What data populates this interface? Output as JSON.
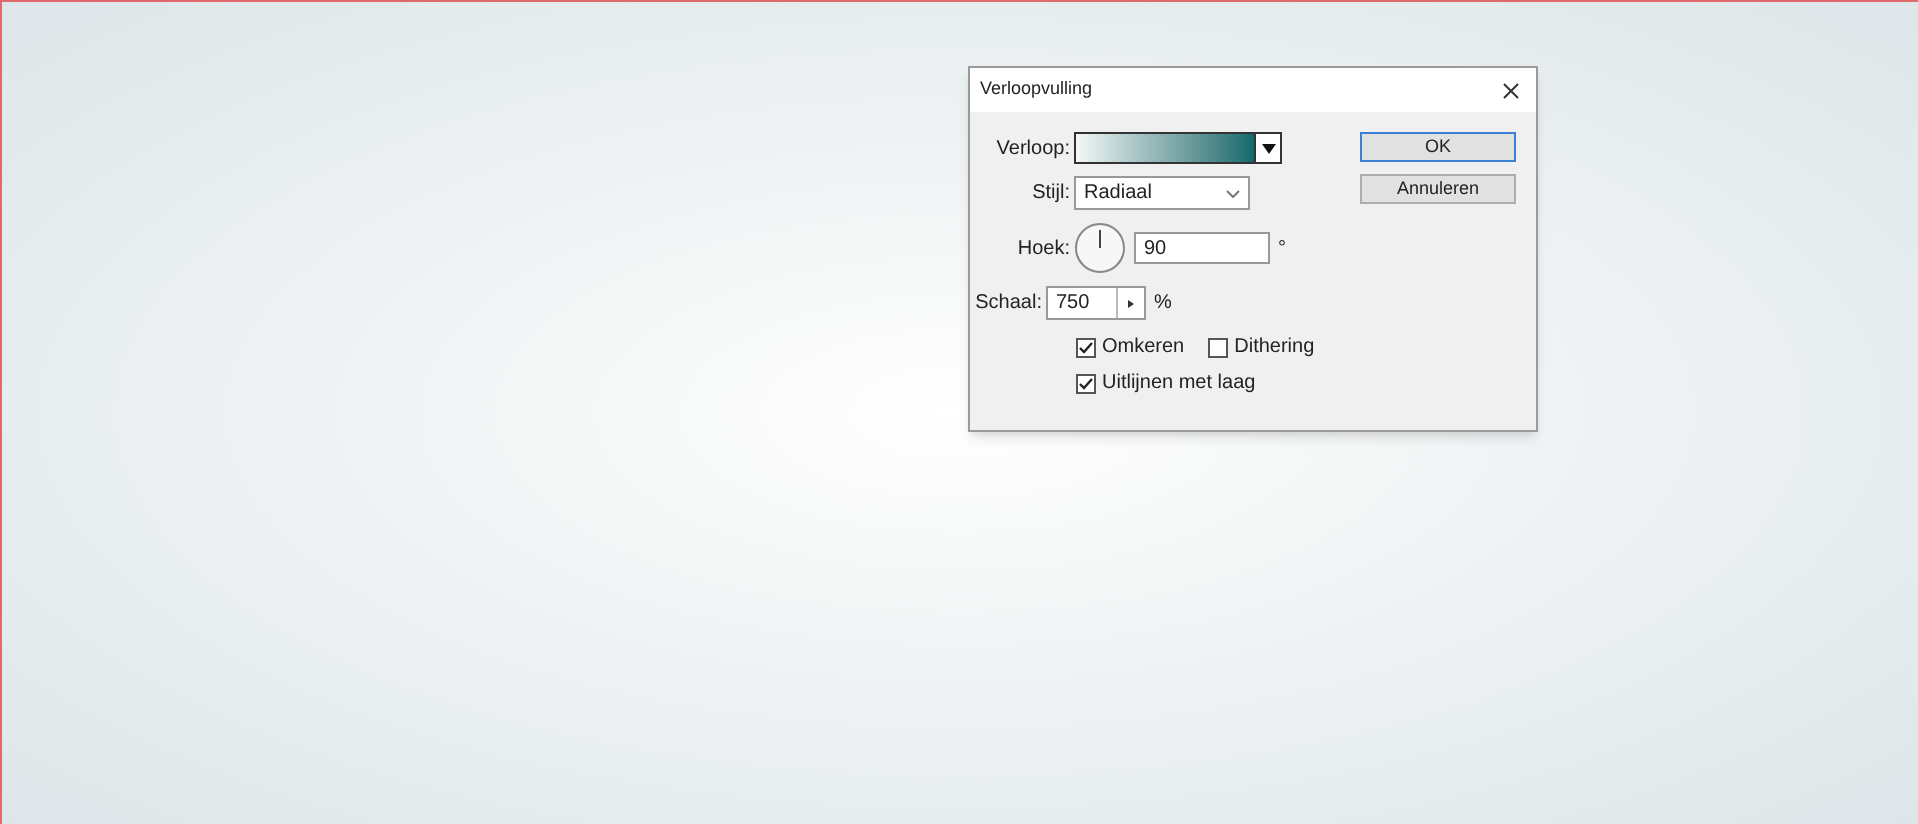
{
  "dialog": {
    "title": "Verloopvulling",
    "gradient": {
      "label": "Verloop:"
    },
    "style": {
      "label": "Stijl:",
      "value": "Radiaal"
    },
    "angle": {
      "label": "Hoek:",
      "value": "90",
      "unit": "°"
    },
    "scale": {
      "label": "Schaal:",
      "value": "750",
      "unit": "%"
    },
    "checkboxes": [
      {
        "label": "Omkeren",
        "checked": true
      },
      {
        "label": "Dithering",
        "checked": false
      },
      {
        "label": "Uitlijnen met laag",
        "checked": true
      }
    ],
    "buttons": [
      "OK",
      "Annuleren"
    ]
  }
}
